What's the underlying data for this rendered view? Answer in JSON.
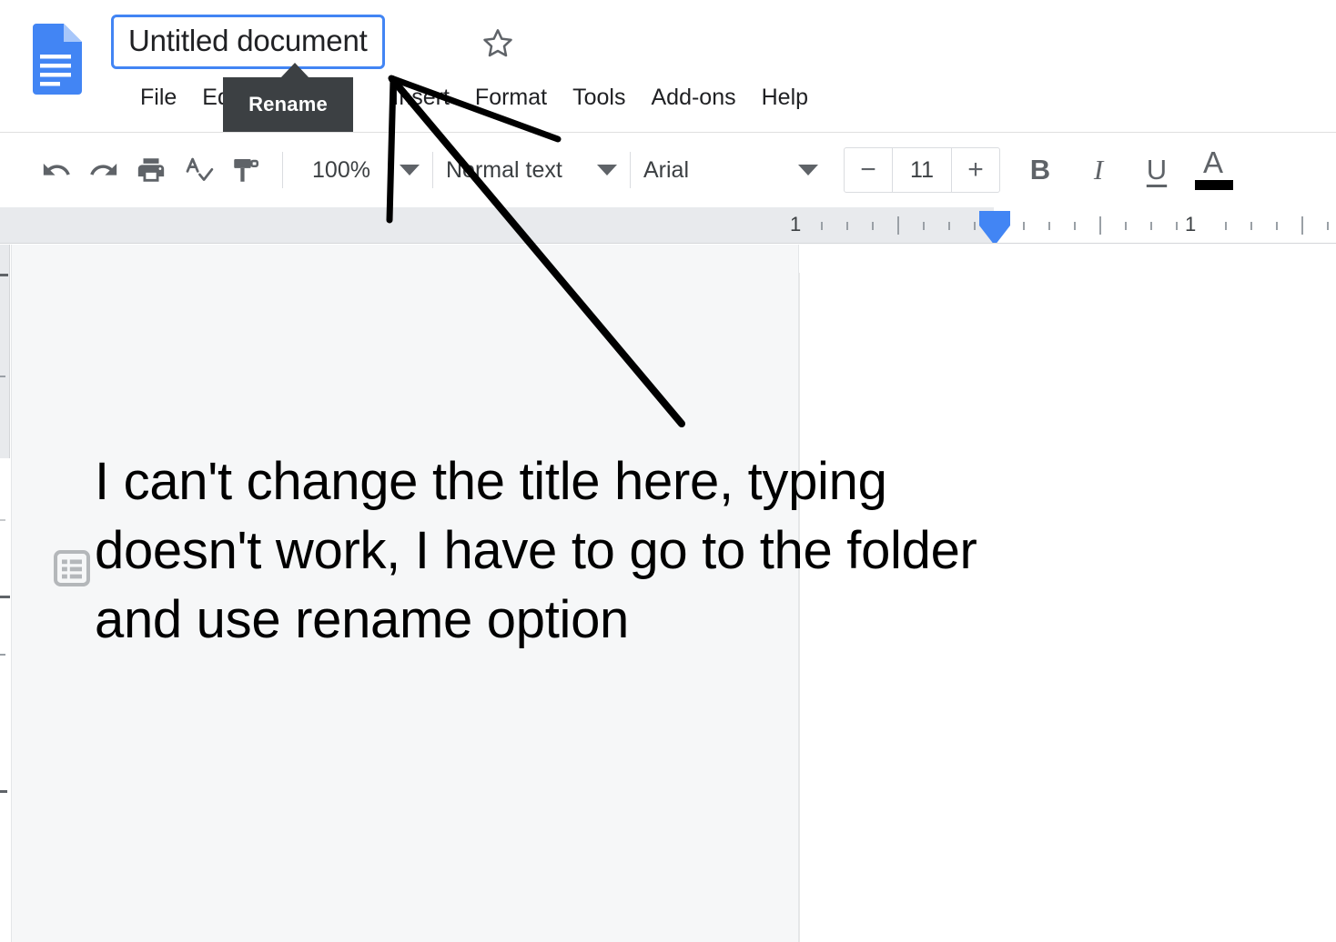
{
  "app": {
    "name": "Google Docs",
    "logo_icon": "google-docs-icon"
  },
  "header": {
    "document_title": "Untitled document",
    "title_placeholder": "Untitled document",
    "star_icon": "star-outline-icon",
    "tooltip": {
      "label": "Rename"
    },
    "menus": [
      {
        "label": "File"
      },
      {
        "label": "Edit"
      },
      {
        "label": "Insert"
      },
      {
        "label": "Format"
      },
      {
        "label": "Tools"
      },
      {
        "label": "Add-ons"
      },
      {
        "label": "Help"
      }
    ]
  },
  "toolbar": {
    "undo_icon": "undo-icon",
    "redo_icon": "redo-icon",
    "print_icon": "print-icon",
    "spellcheck_icon": "spellcheck-icon",
    "paint_format_icon": "paint-format-icon",
    "zoom_level": "100%",
    "paragraph_style": "Normal text",
    "font_family": "Arial",
    "font_size": "11",
    "decrease_font_label": "−",
    "increase_font_label": "+",
    "bold_label": "B",
    "italic_label": "I",
    "underline_label": "U",
    "text_color_label": "A",
    "text_color_value": "#000000",
    "dropdown_icon": "chevron-down-icon"
  },
  "ruler": {
    "left_number": "1",
    "right_number": "1",
    "indent_marker_icon": "indent-marker-icon"
  },
  "sidebar": {
    "outline_icon": "document-outline-icon"
  },
  "document": {
    "body_text": "I can't change the title here, typing doesn't work, I have to go to the folder and use rename option"
  },
  "annotation": {
    "stroke_color": "#000000",
    "kind": "hand-drawn-arrow",
    "points_to": "Untitled document"
  },
  "colors": {
    "accent_blue": "#4285f4",
    "canvas_gray": "#f6f7f8",
    "ruler_gray": "#e8eaed",
    "tooltip_bg": "#3c4043",
    "icon_gray": "#5f6368"
  }
}
